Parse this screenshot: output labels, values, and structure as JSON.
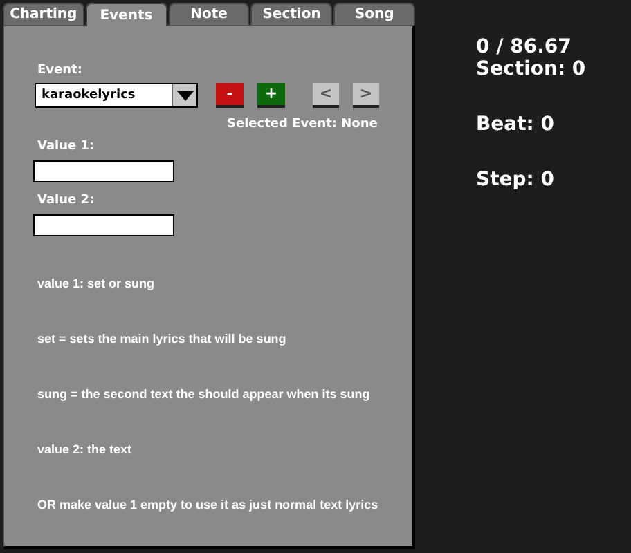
{
  "tabs": [
    {
      "label": "Charting",
      "selected": false
    },
    {
      "label": "Events",
      "selected": true
    },
    {
      "label": "Note",
      "selected": false
    },
    {
      "label": "Section",
      "selected": false
    },
    {
      "label": "Song",
      "selected": false
    }
  ],
  "event_label": "Event:",
  "event_dropdown": {
    "value": "karaokelyrics"
  },
  "event_buttons": [
    {
      "kind": "remove",
      "label": "-"
    },
    {
      "kind": "add",
      "label": "+"
    },
    {
      "kind": "prev",
      "label": "<"
    },
    {
      "kind": "next",
      "label": ">"
    }
  ],
  "selected_event": "Selected Event: None",
  "fields": [
    {
      "label": "Value 1:"
    },
    {
      "label": "Value 2:"
    }
  ],
  "help_lines": [
    "value 1: set or sung",
    "set = sets the main lyrics that will be sung",
    "sung = the second text the should appear when its sung",
    "value 2: the text",
    "OR make value 1 empty to use it as just normal text lyrics"
  ],
  "stat_groups": [
    [
      "0 / 86.67",
      "Section: 0"
    ],
    [
      "Beat: 0"
    ],
    [
      "Step: 0"
    ]
  ]
}
